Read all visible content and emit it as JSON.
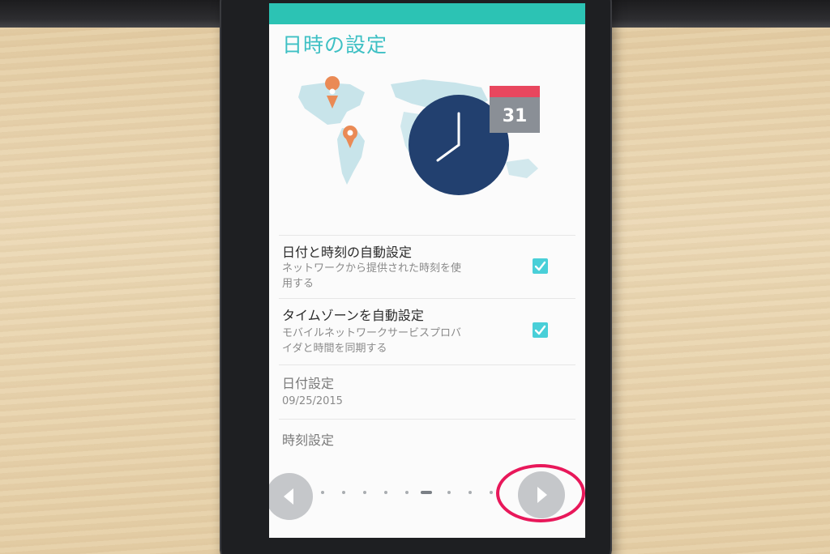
{
  "screen": {
    "title": "日時の設定",
    "accent_color": "#2cc3b4",
    "illustration": {
      "icons": [
        "world-map",
        "location-pin-icon",
        "clock-icon",
        "calendar-icon"
      ],
      "calendar_day": "31"
    },
    "settings": [
      {
        "title": "日付と時刻の自動設定",
        "subtitle_line1": "ネットワークから提供された時刻を使",
        "subtitle_line2": "用する",
        "checked": true
      },
      {
        "title": "タイムゾーンを自動設定",
        "subtitle_line1": "モバイルネットワークサービスプロバ",
        "subtitle_line2": "イダと時間を同期する",
        "checked": true
      },
      {
        "title": "日付設定",
        "value": "09/25/2015"
      },
      {
        "title": "時刻設定"
      }
    ],
    "pager": {
      "total_pages": 10,
      "current_page": 6
    }
  },
  "annotation": {
    "highlight_color": "#e8185a",
    "target": "next-button"
  }
}
